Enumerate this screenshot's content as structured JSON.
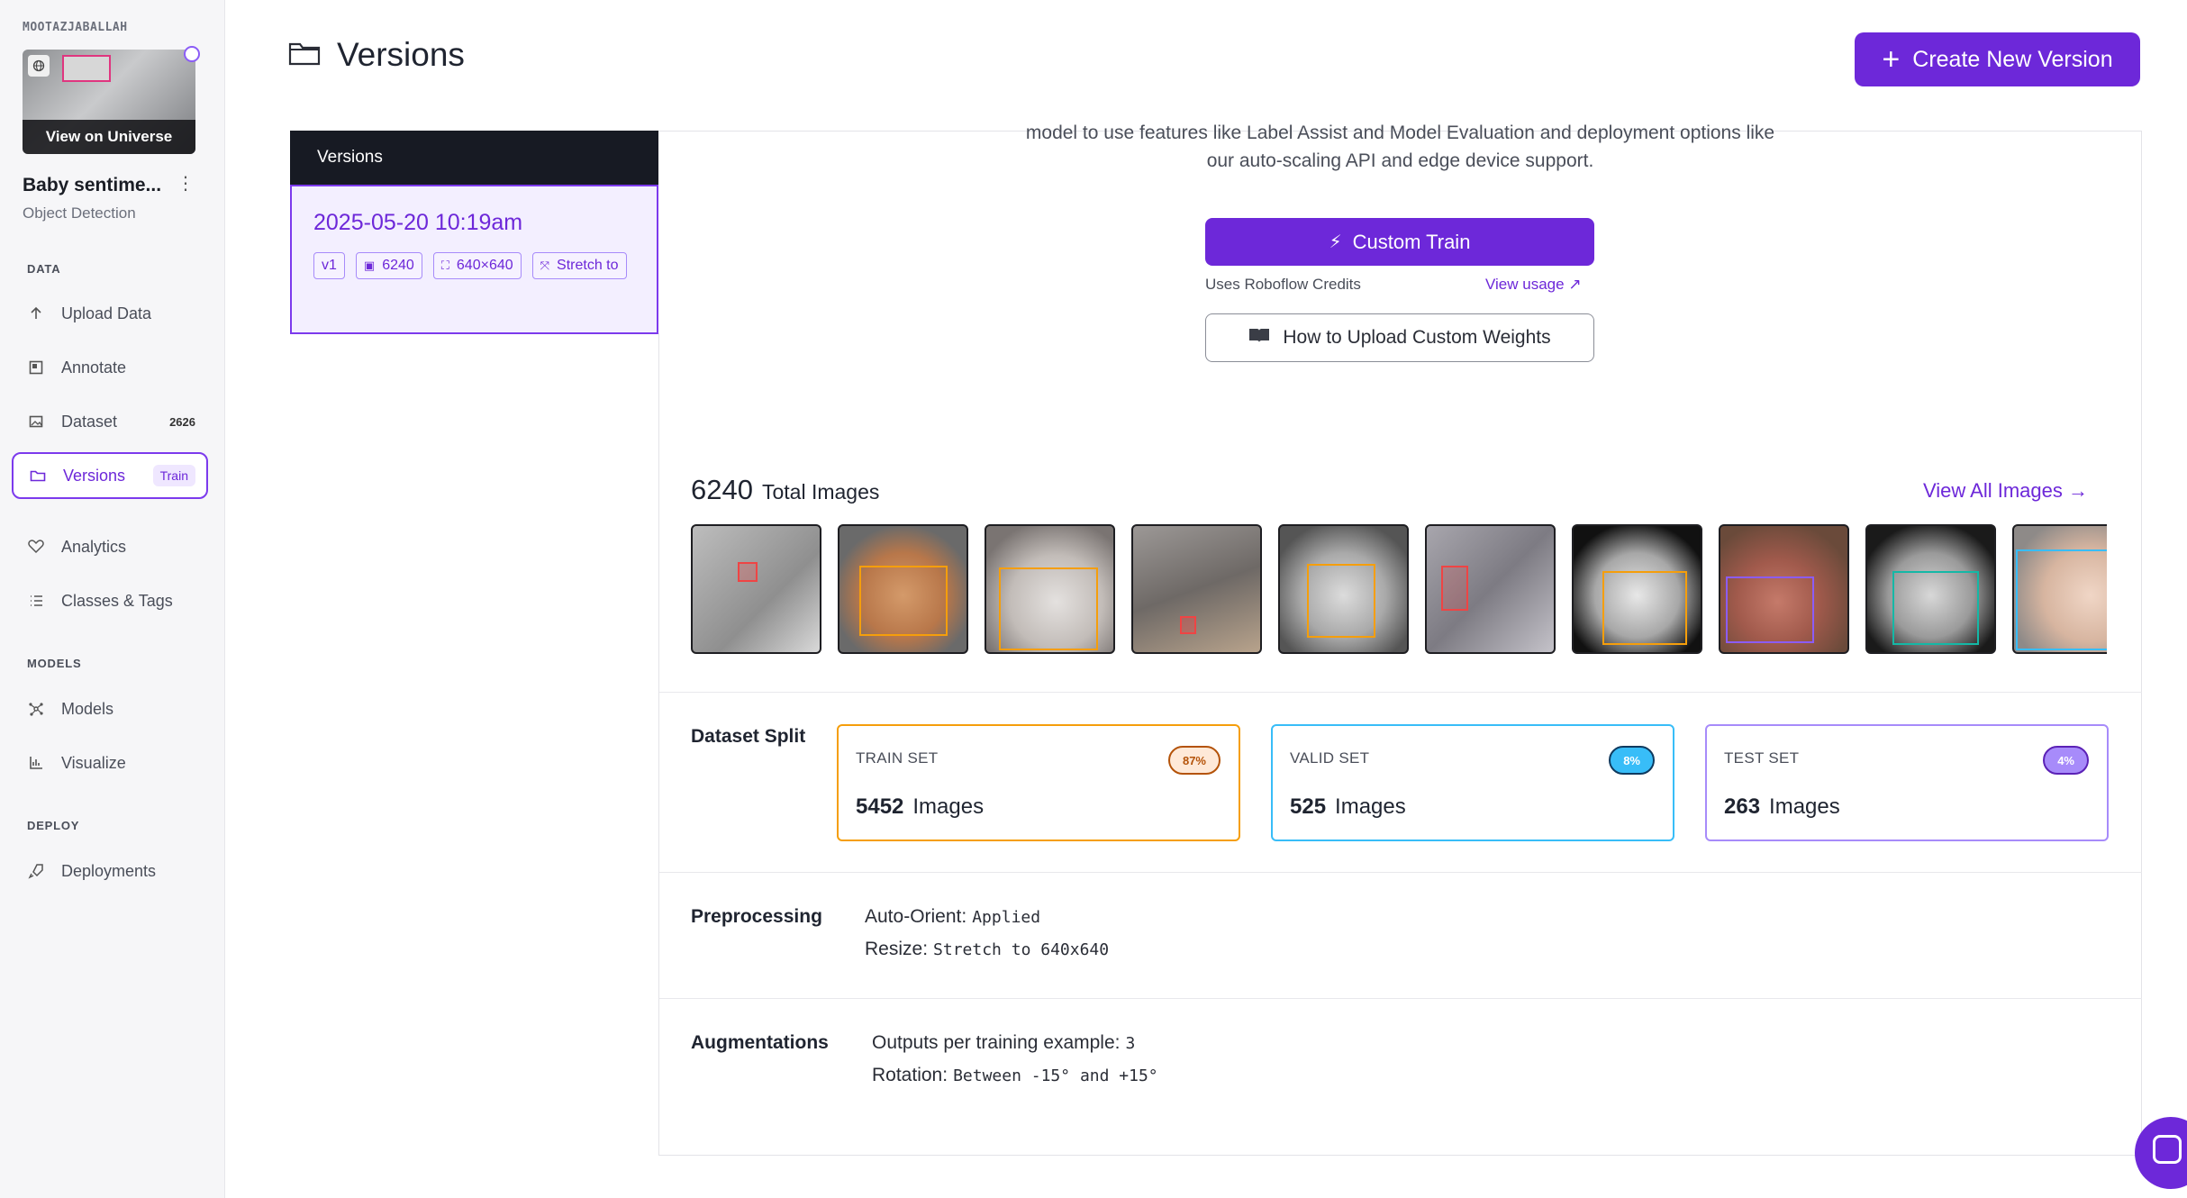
{
  "workspace": "MOOTAZJABALLAH",
  "project": {
    "thumbnail_button": "View on Universe",
    "title": "Baby sentime...",
    "type": "Object Detection"
  },
  "nav": {
    "data_section": "DATA",
    "upload": "Upload Data",
    "annotate": "Annotate",
    "dataset": "Dataset",
    "dataset_count": "2626",
    "versions": "Versions",
    "versions_badge": "Train",
    "analytics": "Analytics",
    "classes": "Classes & Tags",
    "models_section": "MODELS",
    "models": "Models",
    "visualize": "Visualize",
    "deploy_section": "DEPLOY",
    "deployments": "Deployments"
  },
  "header": {
    "title": "Versions",
    "create_button": "Create New Version"
  },
  "versions_panel": {
    "heading": "Versions",
    "selected": {
      "date": "2025-05-20 10:19am",
      "tags": [
        "v1",
        "6240",
        "640×640",
        "Stretch to"
      ]
    }
  },
  "train": {
    "intro_line1": "model to use features like Label Assist and Model Evaluation and deployment options like",
    "intro_line2": "our auto-scaling API and edge device support.",
    "custom_train_button": "Custom Train",
    "uses_credits": "Uses Roboflow Credits",
    "view_usage": "View usage",
    "upload_weights_button": "How to Upload Custom Weights"
  },
  "images": {
    "total": "6240",
    "total_label": "Total Images",
    "view_all": "View All Images"
  },
  "split": {
    "label": "Dataset Split",
    "cards": [
      {
        "name": "TRAIN SET",
        "pct": "87%",
        "count": "5452",
        "unit": "Images",
        "color": "#f59e0b"
      },
      {
        "name": "VALID SET",
        "pct": "8%",
        "count": "525",
        "unit": "Images",
        "color": "#38bdf8"
      },
      {
        "name": "TEST SET",
        "pct": "4%",
        "count": "263",
        "unit": "Images",
        "color": "#a78bfa"
      }
    ]
  },
  "preprocessing": {
    "label": "Preprocessing",
    "auto_orient_key": "Auto-Orient:",
    "auto_orient_val": "Applied",
    "resize_key": "Resize:",
    "resize_val": "Stretch to 640x640"
  },
  "augmentations": {
    "label": "Augmentations",
    "outputs_key": "Outputs per training example:",
    "outputs_val": "3",
    "rotation_key": "Rotation:",
    "rotation_val": "Between -15° and +15°"
  },
  "colors": {
    "accent": "#6d28d9",
    "sidebar_bg": "#f6f6f8",
    "dark_header": "#171a23"
  }
}
